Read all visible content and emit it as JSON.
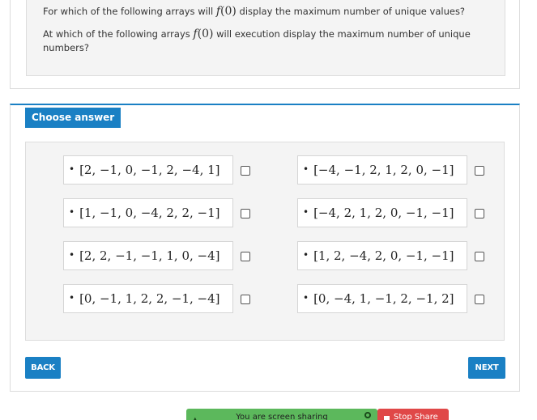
{
  "question": {
    "line1_prefix": "For which of the following arrays will",
    "line1_suffix": "display the maximum number of unique values?",
    "line2_prefix": "At which of the following arrays",
    "line2_suffix": "will execution display the maximum number of unique numbers?",
    "func_name": "f",
    "func_arg": "(0)"
  },
  "answer": {
    "choose_label": "Choose answer",
    "options": [
      "[2, −1, 0, −1, 2, −4, 1]",
      "[−4, −1, 2, 1, 2, 0, −1]",
      "[1, −1, 0, −4, 2, 2, −1]",
      "[−4, 2, 1, 2, 0, −1, −1]",
      "[2, 2, −1, −1, 1, 0, −4]",
      "[1, 2, −4, 2, 0, −1, −1]",
      "[0, −1, 1, 2, 2, −1, −4]",
      "[0, −4, 1, −1, 2, −1, 2]"
    ],
    "bullet": "•"
  },
  "nav": {
    "back_label": "BACK",
    "next_label": "NEXT"
  },
  "share": {
    "status_text": "You are screen sharing",
    "stop_label": "Stop Share"
  },
  "colors": {
    "accent": "#1a80c4",
    "share_bar": "#5cb85c",
    "stop_button": "#e04848"
  }
}
